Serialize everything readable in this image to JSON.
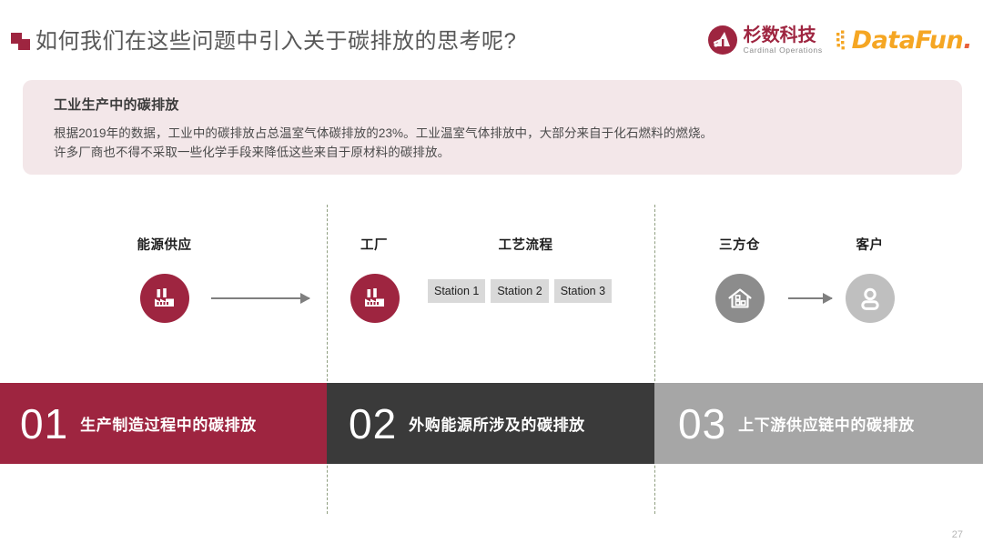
{
  "header": {
    "title": "如何我们在这些问题中引入关于碳排放的思考呢?",
    "bullet_icon": "double-square-bullet-icon"
  },
  "logos": {
    "cardinal": {
      "cn": "杉数科技",
      "en": "Cardinal Operations",
      "mark_icon": "cardinal-circle-logo-icon",
      "color": "#9e2540"
    },
    "datafun": {
      "text_a": "DataFun",
      "text_b": ".",
      "dots_icon": "datafun-dots-icon",
      "color": "#f5a623",
      "accent_color": "#e8603c"
    }
  },
  "callout": {
    "title": "工业生产中的碳排放",
    "line1": "根据2019年的数据，工业中的碳排放占总温室气体碳排放的23%。工业温室气体排放中，大部分来自于化石燃料的燃烧。",
    "line2": "许多厂商也不得不采取一些化学手段来降低这些来自于原材料的碳排放。",
    "background": "#f3e7e9"
  },
  "diagram": {
    "nodes": [
      {
        "label": "能源供应",
        "icon": "factory-icon",
        "color": "#9e2540"
      },
      {
        "label": "工厂",
        "icon": "factory-icon",
        "color": "#9e2540"
      },
      {
        "label": "三方仓",
        "icon": "warehouse-house-icon",
        "color": "#8c8c8c"
      },
      {
        "label": "客户",
        "icon": "person-user-icon",
        "color": "#bfbfbf"
      }
    ],
    "process": {
      "label": "工艺流程",
      "stations": [
        "Station 1",
        "Station 2",
        "Station 3"
      ]
    },
    "arrows": [
      "arrow-energy-to-factory",
      "arrow-warehouse-to-customer"
    ],
    "divider_color": "#8f9e80"
  },
  "bars": [
    {
      "number": "01",
      "label": "生产制造过程中的碳排放",
      "color": "#9e2540"
    },
    {
      "number": "02",
      "label": "外购能源所涉及的碳排放",
      "color": "#3a3a3a"
    },
    {
      "number": "03",
      "label": "上下游供应链中的碳排放",
      "color": "#a6a6a6"
    }
  ],
  "footer": {
    "page_number": "27"
  }
}
